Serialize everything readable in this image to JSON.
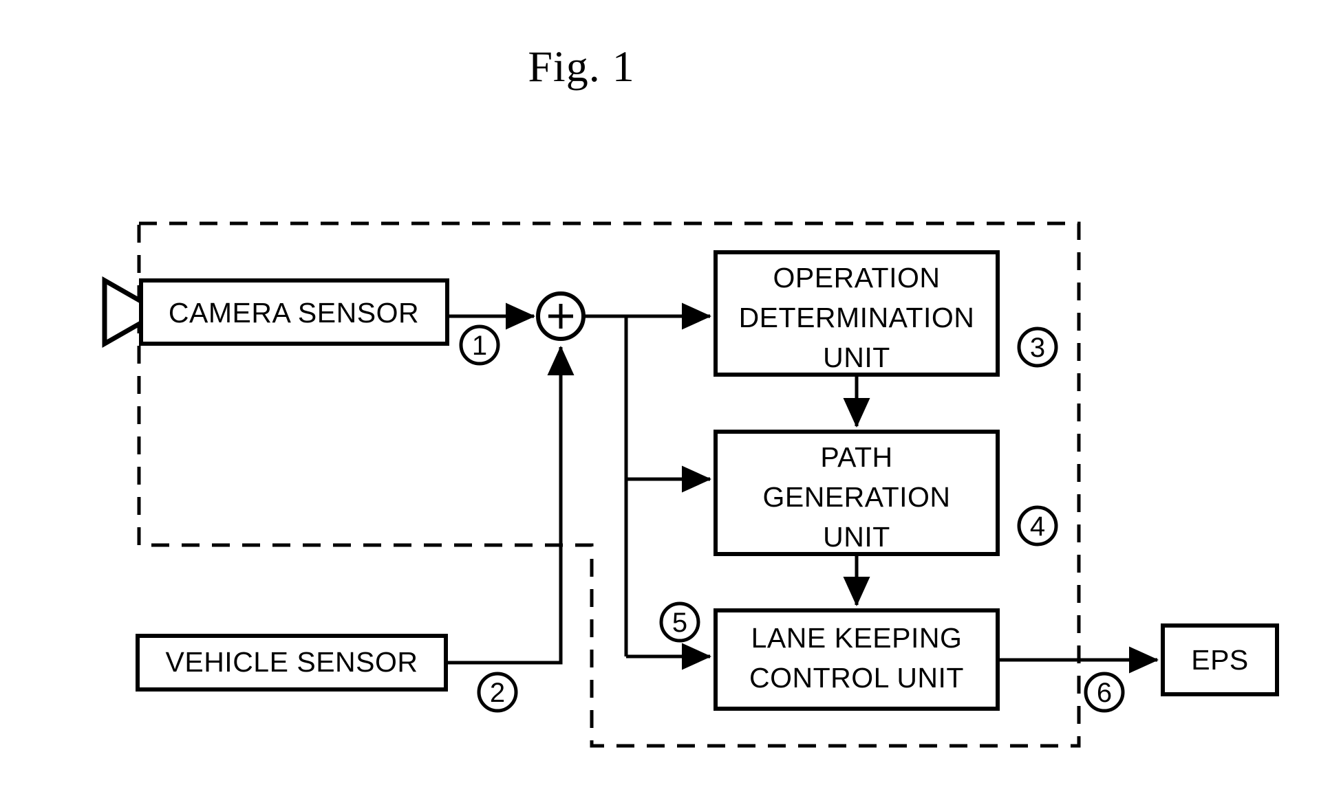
{
  "figure": {
    "title": "Fig. 1",
    "type": "block-diagram",
    "accent_color": "#000000",
    "background_color": "#ffffff"
  },
  "blocks": {
    "camera_sensor": {
      "label": "CAMERA SENSOR",
      "ref": "1"
    },
    "vehicle_sensor": {
      "label": "VEHICLE SENSOR",
      "ref": "2"
    },
    "operation_determination_unit": {
      "line1": "OPERATION",
      "line2": "DETERMINATION",
      "line3": "UNIT",
      "ref": "3"
    },
    "path_generation_unit": {
      "line1": "PATH",
      "line2": "GENERATION",
      "line3": "UNIT",
      "ref": "4"
    },
    "lane_keeping_control_unit": {
      "line1": "LANE KEEPING",
      "line2": "CONTROL UNIT",
      "ref": "5"
    },
    "eps": {
      "label": "EPS",
      "ref": "6"
    }
  },
  "nodes": {
    "summing_junction": {
      "symbol": "+"
    }
  },
  "icons": {
    "camera": "camera-lens-icon"
  }
}
